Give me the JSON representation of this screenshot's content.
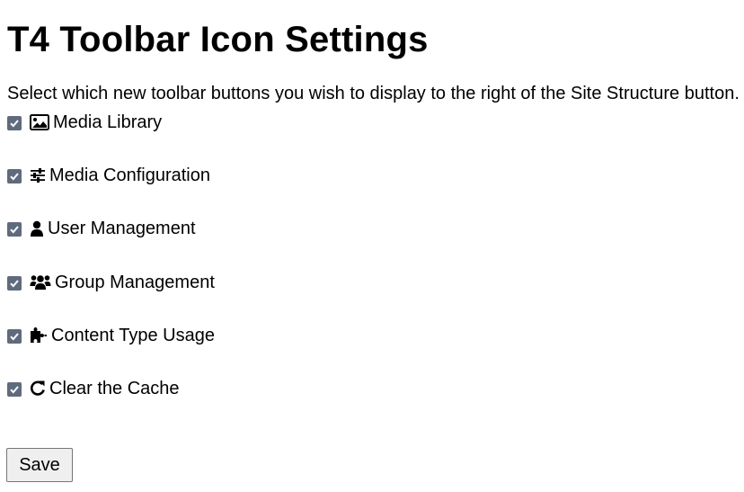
{
  "page": {
    "title": "T4 Toolbar Icon Settings",
    "description": "Select which new toolbar buttons you wish to display to the right of the Site Structure button."
  },
  "options": [
    {
      "label": "Media Library",
      "checked": true,
      "icon": "image-icon"
    },
    {
      "label": "Media Configuration",
      "checked": true,
      "icon": "sliders-icon"
    },
    {
      "label": "User Management",
      "checked": true,
      "icon": "user-icon"
    },
    {
      "label": "Group Management",
      "checked": true,
      "icon": "users-icon"
    },
    {
      "label": "Content Type Usage",
      "checked": true,
      "icon": "puzzle-icon"
    },
    {
      "label": "Clear the Cache",
      "checked": true,
      "icon": "refresh-icon"
    }
  ],
  "form": {
    "save_label": "Save"
  },
  "colors": {
    "checkbox_fill": "#5f6b7d",
    "button_bg": "#efefef",
    "button_border": "#767676"
  }
}
